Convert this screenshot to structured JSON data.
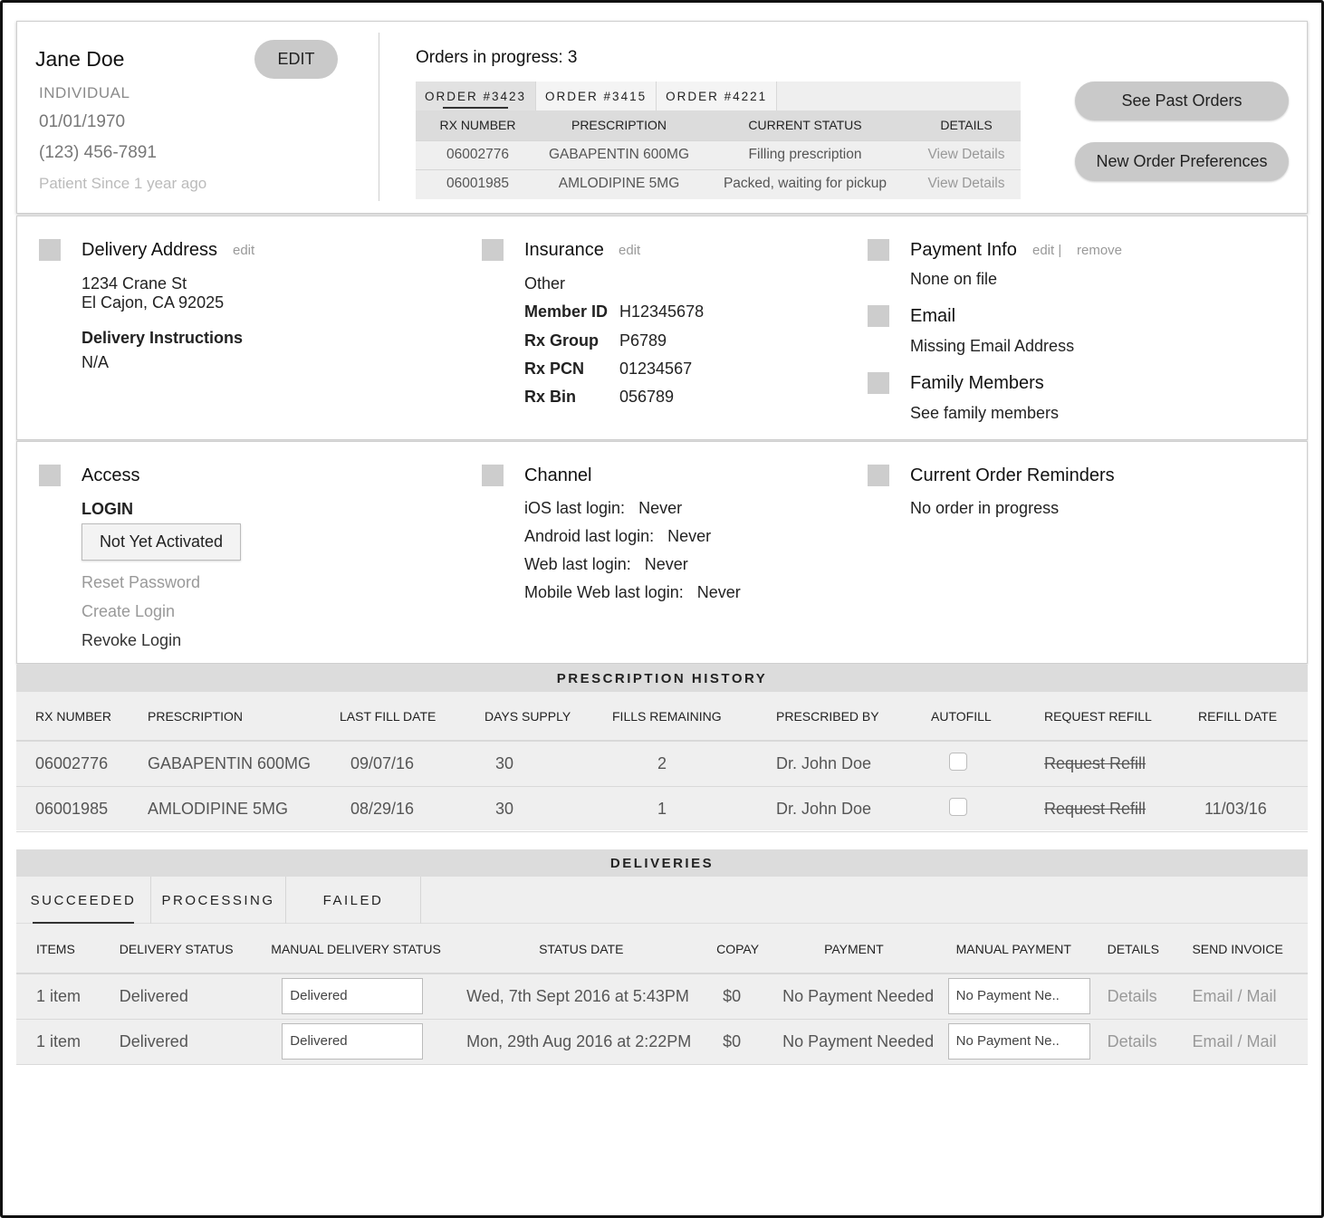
{
  "patient": {
    "name": "Jane Doe",
    "edit_label": "EDIT",
    "type": "INDIVIDUAL",
    "dob": "01/01/1970",
    "phone": "(123) 456-7891",
    "since": "Patient Since 1 year ago"
  },
  "orders": {
    "title": "Orders in progress: 3",
    "tabs": [
      "ORDER #3423",
      "ORDER #3415",
      "ORDER #4221"
    ],
    "active_tab": 0,
    "columns": [
      "RX NUMBER",
      "PRESCRIPTION",
      "CURRENT STATUS",
      "DETAILS"
    ],
    "rows": [
      {
        "rx": "06002776",
        "prescription": "GABAPENTIN 600MG",
        "status": "Filling prescription",
        "details": "View Details"
      },
      {
        "rx": "06001985",
        "prescription": "AMLODIPINE 5MG",
        "status": "Packed, waiting for pickup",
        "details": "View Details"
      }
    ]
  },
  "actions": {
    "see_past": "See Past Orders",
    "new_pref": "New Order Preferences"
  },
  "delivery_address": {
    "title": "Delivery Address",
    "edit": "edit",
    "line1": "1234 Crane St",
    "line2": "El Cajon, CA 92025",
    "instructions_label": "Delivery Instructions",
    "instructions": "N/A"
  },
  "insurance": {
    "title": "Insurance",
    "edit": "edit",
    "type": "Other",
    "fields": [
      {
        "label": "Member ID",
        "value": "H12345678"
      },
      {
        "label": "Rx Group",
        "value": "P6789"
      },
      {
        "label": "Rx PCN",
        "value": "01234567"
      },
      {
        "label": "Rx Bin",
        "value": "056789"
      }
    ]
  },
  "payment": {
    "title": "Payment Info",
    "edit": "edit |",
    "remove": "remove",
    "value": "None on file"
  },
  "email": {
    "title": "Email",
    "value": "Missing Email Address"
  },
  "family": {
    "title": "Family Members",
    "link": "See family members"
  },
  "access": {
    "title": "Access",
    "login_label": "LOGIN",
    "status": "Not Yet Activated",
    "reset": "Reset Password",
    "create": "Create Login",
    "revoke": "Revoke Login"
  },
  "channel": {
    "title": "Channel",
    "items": [
      {
        "label": "iOS last login:",
        "value": "Never"
      },
      {
        "label": "Android last login:",
        "value": "Never"
      },
      {
        "label": "Web last login:",
        "value": "Never"
      },
      {
        "label": "Mobile Web last login:",
        "value": "Never"
      }
    ]
  },
  "reminders": {
    "title": "Current Order Reminders",
    "value": "No order in progress"
  },
  "rx_history": {
    "title": "PRESCRIPTION HISTORY",
    "columns": [
      "RX NUMBER",
      "PRESCRIPTION",
      "LAST FILL DATE",
      "DAYS SUPPLY",
      "FILLS REMAINING",
      "PRESCRIBED BY",
      "AUTOFILL",
      "REQUEST REFILL",
      "REFILL DATE"
    ],
    "rows": [
      {
        "rx": "06002776",
        "prescription": "GABAPENTIN 600MG",
        "last_fill": "09/07/16",
        "days": "30",
        "fills": "2",
        "prescriber": "Dr. John Doe",
        "autofill": false,
        "request": "Request Refill",
        "refill_date": ""
      },
      {
        "rx": "06001985",
        "prescription": "AMLODIPINE 5MG",
        "last_fill": "08/29/16",
        "days": "30",
        "fills": "1",
        "prescriber": "Dr. John Doe",
        "autofill": false,
        "request": "Request Refill",
        "refill_date": "11/03/16"
      }
    ]
  },
  "deliveries": {
    "title": "DELIVERIES",
    "tabs": [
      "SUCCEEDED",
      "PROCESSING",
      "FAILED"
    ],
    "active_tab": 0,
    "columns": [
      "ITEMS",
      "DELIVERY STATUS",
      "MANUAL DELIVERY STATUS",
      "STATUS DATE",
      "COPAY",
      "PAYMENT",
      "MANUAL PAYMENT",
      "DETAILS",
      "SEND INVOICE"
    ],
    "rows": [
      {
        "items": "1 item",
        "status": "Delivered",
        "manual_status": "Delivered",
        "date": "Wed, 7th Sept 2016 at 5:43PM",
        "copay": "$0",
        "payment": "No Payment Needed",
        "manual_payment": "No Payment Ne..",
        "details": "Details",
        "invoice": "Email / Mail"
      },
      {
        "items": "1 item",
        "status": "Delivered",
        "manual_status": "Delivered",
        "date": "Mon, 29th Aug 2016 at 2:22PM",
        "copay": "$0",
        "payment": "No Payment Needed",
        "manual_payment": "No Payment Ne..",
        "details": "Details",
        "invoice": "Email / Mail"
      }
    ]
  }
}
